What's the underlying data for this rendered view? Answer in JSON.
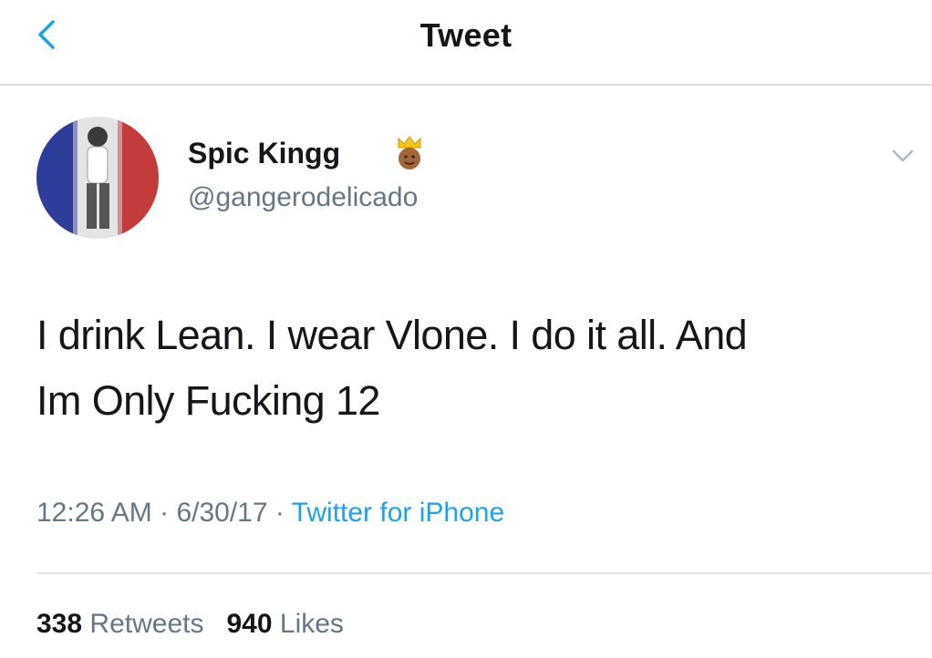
{
  "header": {
    "title": "Tweet",
    "back_icon": "chevron-left-icon",
    "accent_color": "#1da1f2"
  },
  "tweet": {
    "display_name": "Spic Kingg",
    "name_emoji": "crown-emoji",
    "handle": "@gangerodelicado",
    "menu_icon": "chevron-down-icon",
    "text_line_1": "I drink Lean. I wear Vlone. I do it all. And",
    "text_line_2": "Im Only Fucking 12",
    "time": "12:26 AM",
    "date": "6/30/17",
    "separator": "·",
    "source": "Twitter for iPhone"
  },
  "stats": {
    "retweets_count": "338",
    "retweets_label": "Retweets",
    "likes_count": "940",
    "likes_label": "Likes"
  }
}
